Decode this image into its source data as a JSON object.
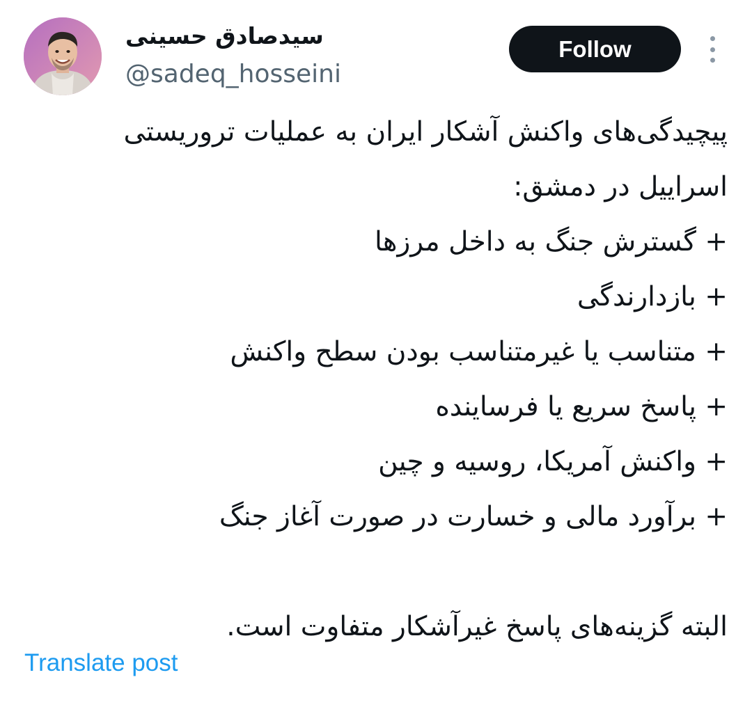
{
  "author": {
    "display_name": "سیدصادق حسینی",
    "handle": "@sadeq_hosseini",
    "avatar": "avatar-photo-icon"
  },
  "actions": {
    "follow_label": "Follow",
    "more_icon": "more-vertical-icon"
  },
  "post": {
    "intro": "پیچیدگی‌های واکنش آشکار ایران به عملیات تروریستی اسراییل در دمشق:",
    "bullets": [
      "+ گسترش جنگ به داخل مرزها",
      "+ بازدارندگی",
      "+ متناسب یا غیرمتناسب بودن سطح واکنش",
      "+ پاسخ سریع یا فرساینده",
      "+ واکنش آمریکا، روسیه و چین",
      "+ برآورد مالی و خسارت در صورت آغاز جنگ"
    ],
    "closing": "البته گزینه‌های پاسخ غیرآشکار متفاوت است."
  },
  "footer": {
    "translate_label": "Translate post"
  },
  "colors": {
    "follow_bg": "#0f1419",
    "link": "#1d9bf0",
    "secondary_text": "#536471",
    "avatar_bg": "#c98ac4"
  }
}
